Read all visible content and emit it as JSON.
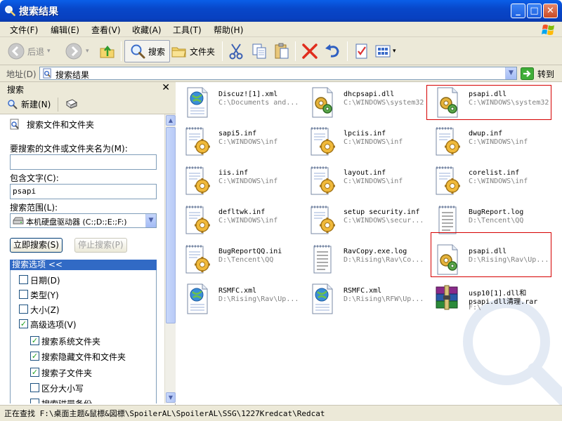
{
  "window": {
    "title": "搜索结果"
  },
  "menu": [
    "文件(F)",
    "编辑(E)",
    "查看(V)",
    "收藏(A)",
    "工具(T)",
    "帮助(H)"
  ],
  "toolbar": {
    "back": "后退",
    "search": "搜索",
    "folders": "文件夹"
  },
  "address": {
    "label": "地址(D)",
    "value": "搜索结果",
    "go": "转到"
  },
  "pane": {
    "title": "搜索",
    "new_label": "新建(N)",
    "heading": "搜索文件和文件夹",
    "name_label": "要搜索的文件或文件夹名为(M):",
    "name_value": "",
    "text_label": "包含文字(C):",
    "text_value": "psapi",
    "scope_label": "搜索范围(L):",
    "scope_value": "本机硬盘驱动器 (C:;D:;E:;F:)",
    "search_now": "立即搜索(S)",
    "stop_search": "停止搜索(P)",
    "options_title": "搜索选项 <<",
    "options": [
      {
        "label": "日期(D)",
        "checked": false
      },
      {
        "label": "类型(Y)",
        "checked": false
      },
      {
        "label": "大小(Z)",
        "checked": false
      },
      {
        "label": "高级选项(V)",
        "checked": true
      }
    ],
    "advanced": [
      {
        "label": "搜索系统文件夹",
        "checked": true
      },
      {
        "label": "搜索隐藏文件和文件夹",
        "checked": true
      },
      {
        "label": "搜索子文件夹",
        "checked": true
      },
      {
        "label": "区分大小写",
        "checked": false
      },
      {
        "label": "搜索磁带备份",
        "checked": false
      }
    ]
  },
  "results": [
    {
      "name": "Discuz![1].xml",
      "path": "C:\\Documents and...",
      "icon": "xml-file-icon"
    },
    {
      "name": "dhcpsapi.dll",
      "path": "C:\\WINDOWS\\system32",
      "icon": "dll-file-icon"
    },
    {
      "name": "psapi.dll",
      "path": "C:\\WINDOWS\\system32",
      "icon": "dll-file-icon"
    },
    {
      "name": "sapi5.inf",
      "path": "C:\\WINDOWS\\inf",
      "icon": "inf-file-icon"
    },
    {
      "name": "lpciis.inf",
      "path": "C:\\WINDOWS\\inf",
      "icon": "inf-file-icon"
    },
    {
      "name": "dwup.inf",
      "path": "C:\\WINDOWS\\inf",
      "icon": "inf-file-icon"
    },
    {
      "name": "iis.inf",
      "path": "C:\\WINDOWS\\inf",
      "icon": "inf-file-icon"
    },
    {
      "name": "layout.inf",
      "path": "C:\\WINDOWS\\inf",
      "icon": "inf-file-icon"
    },
    {
      "name": "corelist.inf",
      "path": "C:\\WINDOWS\\inf",
      "icon": "inf-file-icon"
    },
    {
      "name": "defltwk.inf",
      "path": "C:\\WINDOWS\\inf",
      "icon": "inf-file-icon"
    },
    {
      "name": "setup security.inf",
      "path": "C:\\WINDOWS\\secur...",
      "icon": "inf-file-icon"
    },
    {
      "name": "BugReport.log",
      "path": "D:\\Tencent\\QQ",
      "icon": "log-file-icon"
    },
    {
      "name": "BugReportQQ.ini",
      "path": "D:\\Tencent\\QQ",
      "icon": "inf-file-icon"
    },
    {
      "name": "RavCopy.exe.log",
      "path": "D:\\Rising\\Rav\\Co...",
      "icon": "log-file-icon"
    },
    {
      "name": "psapi.dll",
      "path": "D:\\Rising\\Rav\\Up...",
      "icon": "dll-file-icon"
    },
    {
      "name": "RSMFC.xml",
      "path": "D:\\Rising\\Rav\\Up...",
      "icon": "xml-file-icon"
    },
    {
      "name": "RSMFC.xml",
      "path": "D:\\Rising\\RFW\\Up...",
      "icon": "xml-file-icon"
    },
    {
      "name": "usp10[1].dll和",
      "name2": "psapi.dll清理.rar",
      "path": "F:\\",
      "icon": "rar-file-icon"
    }
  ],
  "status": "正在查找 F:\\桌面主题&鼠標&図標\\SpoilerAL\\SpoilerAL\\SSG\\1227Kredcat\\Redcat"
}
